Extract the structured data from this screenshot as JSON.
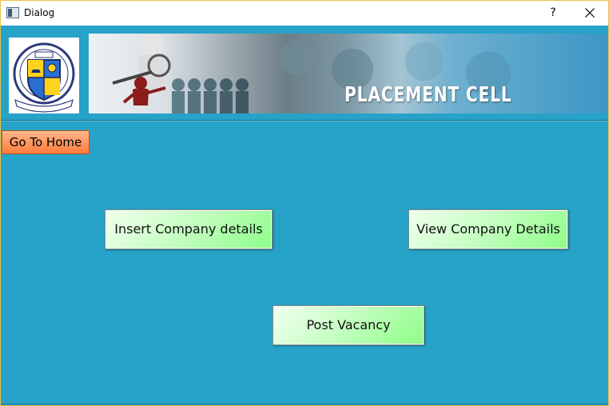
{
  "window": {
    "title": "Dialog",
    "help_label": "?"
  },
  "header": {
    "banner_title": "PLACEMENT CELL"
  },
  "buttons": {
    "home": "Go To Home",
    "insert": "Insert Company details",
    "view": "View Company Details",
    "post": "Post Vacancy"
  },
  "colors": {
    "background": "#27a2c8",
    "home_button": "#ff8a4c",
    "action_button": "#a8ff9f"
  },
  "icons": {
    "app": "dialog-app-icon",
    "close": "close-icon",
    "logo": "college-crest-logo",
    "banner": "magnifier-figures-banner"
  }
}
